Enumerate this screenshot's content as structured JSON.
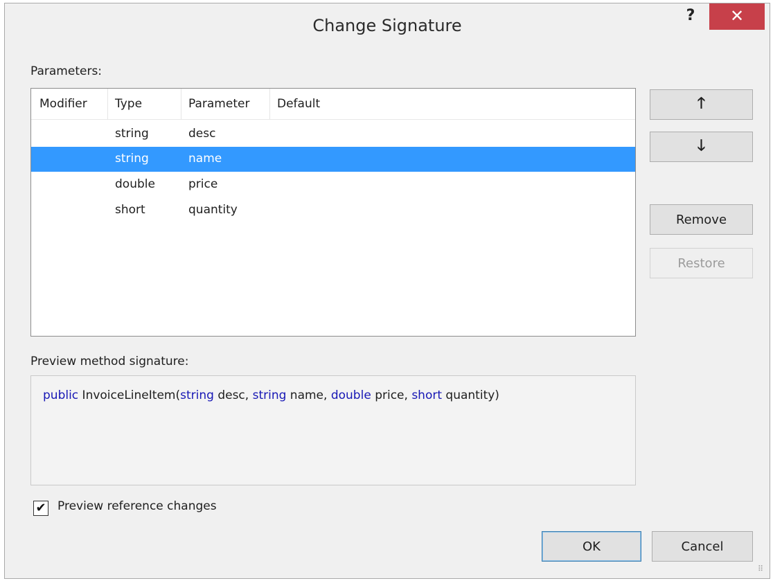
{
  "dialog": {
    "title": "Change Signature",
    "help_label": "?",
    "close_label": "✕"
  },
  "parameters": {
    "label": "Parameters:",
    "columns": [
      "Modifier",
      "Type",
      "Parameter",
      "Default"
    ],
    "rows": [
      {
        "modifier": "",
        "type": "string",
        "parameter": "desc",
        "default": "",
        "selected": false
      },
      {
        "modifier": "",
        "type": "string",
        "parameter": "name",
        "default": "",
        "selected": true
      },
      {
        "modifier": "",
        "type": "double",
        "parameter": "price",
        "default": "",
        "selected": false
      },
      {
        "modifier": "",
        "type": "short",
        "parameter": "quantity",
        "default": "",
        "selected": false
      }
    ]
  },
  "side_buttons": {
    "up_icon": "arrow-up-icon",
    "up_glyph": "🡑",
    "down_icon": "arrow-down-icon",
    "down_glyph": "🡓",
    "remove_label": "Remove",
    "restore_label": "Restore"
  },
  "preview": {
    "label": "Preview method signature:",
    "tokens": [
      {
        "text": "public",
        "kw": true
      },
      {
        "text": " InvoiceLineItem(",
        "kw": false
      },
      {
        "text": "string",
        "kw": true
      },
      {
        "text": " desc, ",
        "kw": false
      },
      {
        "text": "string",
        "kw": true
      },
      {
        "text": " name, ",
        "kw": false
      },
      {
        "text": "double",
        "kw": true
      },
      {
        "text": " price, ",
        "kw": false
      },
      {
        "text": "short",
        "kw": true
      },
      {
        "text": " quantity)",
        "kw": false
      }
    ]
  },
  "options": {
    "preview_reference_changes_label": "Preview reference changes",
    "preview_reference_changes_checked": true,
    "check_glyph": "✔"
  },
  "footer": {
    "ok_label": "OK",
    "cancel_label": "Cancel"
  },
  "colors": {
    "selection": "#3399ff",
    "keyword": "#1717b5",
    "close_button": "#c7404a"
  }
}
